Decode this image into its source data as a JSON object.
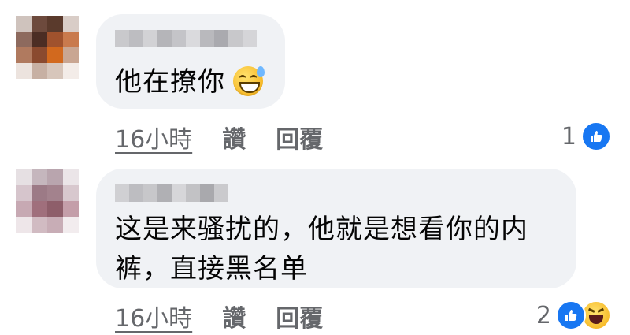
{
  "comments": [
    {
      "text": "他在撩你",
      "emoji": "sweat-smile-emoji",
      "time": "16小時",
      "like_label": "讚",
      "reply_label": "回覆",
      "reaction_count": "1",
      "reactions": [
        "like-icon"
      ]
    },
    {
      "text": "这是来骚扰的，他就是想看你的内裤，直接黑名单",
      "time": "16小時",
      "like_label": "讚",
      "reply_label": "回覆",
      "reaction_count": "2",
      "reactions": [
        "like-icon",
        "haha-icon"
      ]
    }
  ],
  "colors": {
    "bubble": "#f0f2f5",
    "meta_text": "#65676b",
    "like_blue": "#1877f2",
    "text": "#050505"
  }
}
